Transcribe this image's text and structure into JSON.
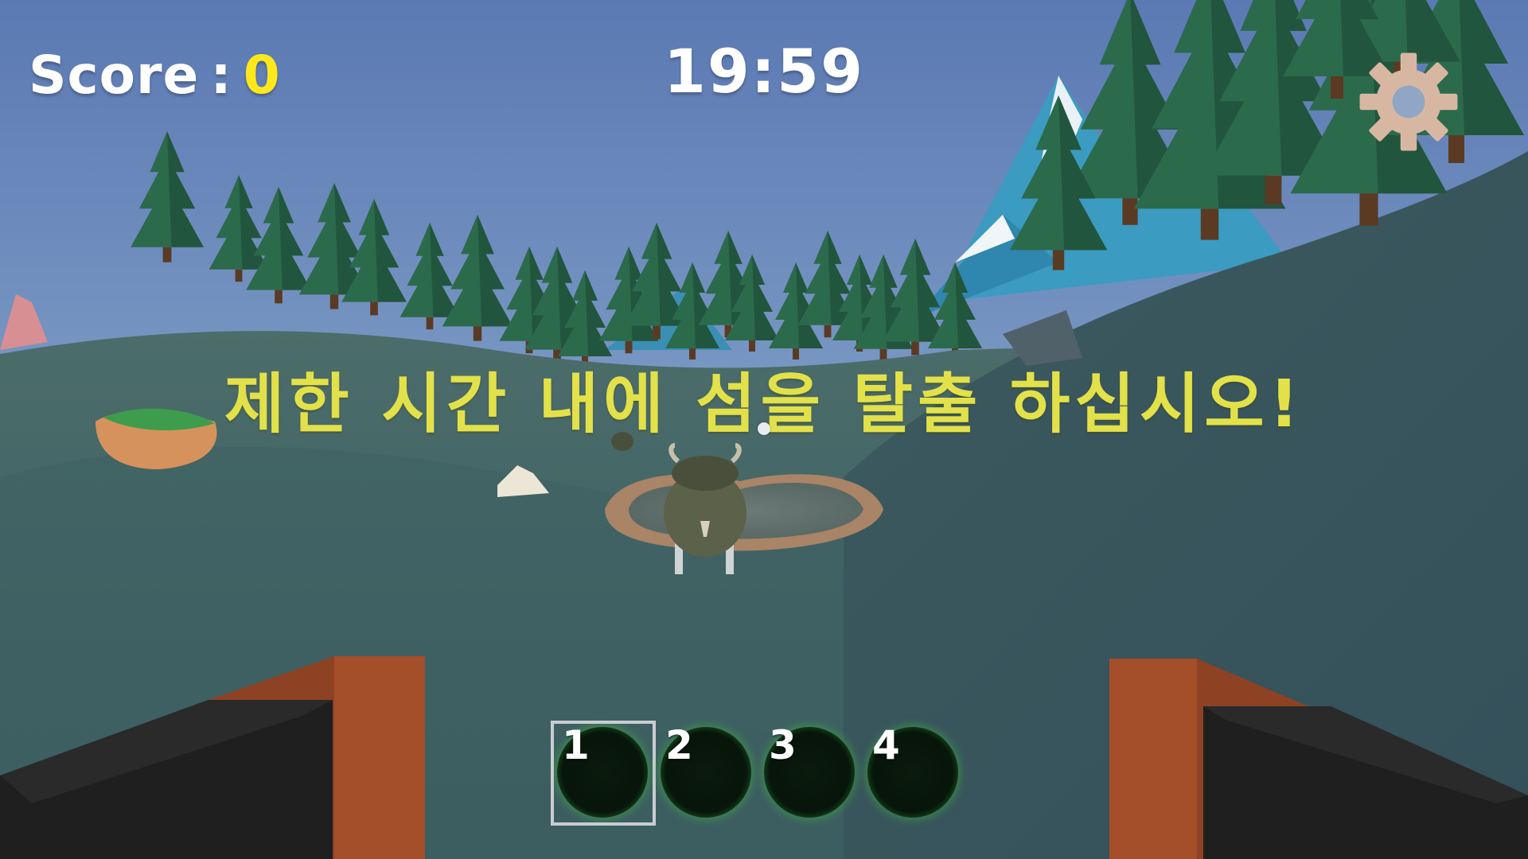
{
  "hud": {
    "score_label": "Score",
    "score_separator": ":",
    "score_value": "0",
    "timer": "19:59",
    "settings_icon": "gear-icon"
  },
  "objective_text": "제한 시간 내에 섬을 탈출 하십시오!",
  "hotbar": {
    "selected_index": 0,
    "slots": [
      {
        "number": "1"
      },
      {
        "number": "2"
      },
      {
        "number": "3"
      },
      {
        "number": "4"
      }
    ]
  },
  "colors": {
    "score_value": "#ffe81a",
    "objective_text": "#e3e14a",
    "sky_top": "#5a7bb6",
    "grass": "#3f6266",
    "gear": "#d8b7a2"
  }
}
